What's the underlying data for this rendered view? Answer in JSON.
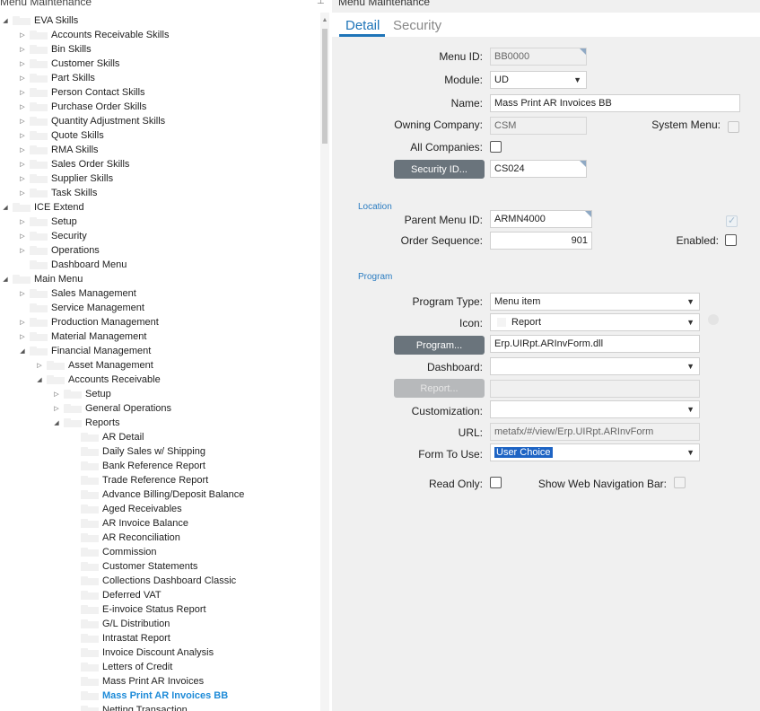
{
  "left_panel": {
    "title": "Menu Maintenance",
    "tree": [
      {
        "label": "EVA Skills",
        "level": 0,
        "expander": "expanded",
        "icon": "folder"
      },
      {
        "label": "Accounts Receivable Skills",
        "level": 1,
        "expander": "collapsed",
        "icon": "folder"
      },
      {
        "label": "Bin Skills",
        "level": 1,
        "expander": "collapsed",
        "icon": "folder"
      },
      {
        "label": "Customer Skills",
        "level": 1,
        "expander": "collapsed",
        "icon": "folder"
      },
      {
        "label": "Part Skills",
        "level": 1,
        "expander": "collapsed",
        "icon": "folder"
      },
      {
        "label": "Person Contact Skills",
        "level": 1,
        "expander": "collapsed",
        "icon": "folder"
      },
      {
        "label": "Purchase Order Skills",
        "level": 1,
        "expander": "collapsed",
        "icon": "folder"
      },
      {
        "label": "Quantity Adjustment Skills",
        "level": 1,
        "expander": "collapsed",
        "icon": "folder"
      },
      {
        "label": "Quote Skills",
        "level": 1,
        "expander": "collapsed",
        "icon": "folder"
      },
      {
        "label": "RMA Skills",
        "level": 1,
        "expander": "collapsed",
        "icon": "folder"
      },
      {
        "label": "Sales Order Skills",
        "level": 1,
        "expander": "collapsed",
        "icon": "folder"
      },
      {
        "label": "Supplier Skills",
        "level": 1,
        "expander": "collapsed",
        "icon": "folder"
      },
      {
        "label": "Task Skills",
        "level": 1,
        "expander": "collapsed",
        "icon": "folder"
      },
      {
        "label": "ICE Extend",
        "level": 0,
        "expander": "expanded",
        "icon": "folder"
      },
      {
        "label": "Setup",
        "level": 1,
        "expander": "collapsed",
        "icon": "folder"
      },
      {
        "label": "Security",
        "level": 1,
        "expander": "collapsed",
        "icon": "folder"
      },
      {
        "label": "Operations",
        "level": 1,
        "expander": "collapsed",
        "icon": "folder"
      },
      {
        "label": "Dashboard Menu",
        "level": 1,
        "expander": "none",
        "icon": "folder"
      },
      {
        "label": "Main Menu",
        "level": 0,
        "expander": "expanded",
        "icon": "folder"
      },
      {
        "label": "Sales Management",
        "level": 1,
        "expander": "collapsed",
        "icon": "folder"
      },
      {
        "label": "Service Management",
        "level": 1,
        "expander": "none",
        "icon": "folder"
      },
      {
        "label": "Production Management",
        "level": 1,
        "expander": "collapsed",
        "icon": "folder"
      },
      {
        "label": "Material Management",
        "level": 1,
        "expander": "collapsed",
        "icon": "folder"
      },
      {
        "label": "Financial Management",
        "level": 1,
        "expander": "expanded",
        "icon": "folder"
      },
      {
        "label": "Asset Management",
        "level": 2,
        "expander": "collapsed",
        "icon": "folder"
      },
      {
        "label": "Accounts Receivable",
        "level": 2,
        "expander": "expanded",
        "icon": "folder"
      },
      {
        "label": "Setup",
        "level": 3,
        "expander": "collapsed",
        "icon": "folder"
      },
      {
        "label": "General Operations",
        "level": 3,
        "expander": "collapsed",
        "icon": "folder"
      },
      {
        "label": "Reports",
        "level": 3,
        "expander": "expanded",
        "icon": "folder"
      },
      {
        "label": "AR Detail",
        "level": 4,
        "expander": "none",
        "icon": "folder"
      },
      {
        "label": "Daily Sales w/ Shipping",
        "level": 4,
        "expander": "none",
        "icon": "folder"
      },
      {
        "label": "Bank Reference Report",
        "level": 4,
        "expander": "none",
        "icon": "folder"
      },
      {
        "label": "Trade Reference Report",
        "level": 4,
        "expander": "none",
        "icon": "folder"
      },
      {
        "label": "Advance Billing/Deposit Balance",
        "level": 4,
        "expander": "none",
        "icon": "folder"
      },
      {
        "label": "Aged Receivables",
        "level": 4,
        "expander": "none",
        "icon": "folder"
      },
      {
        "label": "AR Invoice Balance",
        "level": 4,
        "expander": "none",
        "icon": "folder"
      },
      {
        "label": "AR Reconciliation",
        "level": 4,
        "expander": "none",
        "icon": "folder"
      },
      {
        "label": "Commission",
        "level": 4,
        "expander": "none",
        "icon": "folder"
      },
      {
        "label": "Customer Statements",
        "level": 4,
        "expander": "none",
        "icon": "folder"
      },
      {
        "label": "Collections Dashboard Classic",
        "level": 4,
        "expander": "none",
        "icon": "folder"
      },
      {
        "label": "Deferred VAT",
        "level": 4,
        "expander": "none",
        "icon": "folder"
      },
      {
        "label": "E-invoice Status Report",
        "level": 4,
        "expander": "none",
        "icon": "folder"
      },
      {
        "label": "G/L Distribution",
        "level": 4,
        "expander": "none",
        "icon": "folder"
      },
      {
        "label": "Intrastat Report",
        "level": 4,
        "expander": "none",
        "icon": "folder"
      },
      {
        "label": "Invoice Discount Analysis",
        "level": 4,
        "expander": "none",
        "icon": "folder"
      },
      {
        "label": "Letters of Credit",
        "level": 4,
        "expander": "none",
        "icon": "folder"
      },
      {
        "label": "Mass Print AR Invoices",
        "level": 4,
        "expander": "none",
        "icon": "folder"
      },
      {
        "label": "Mass Print AR Invoices BB",
        "level": 4,
        "expander": "none",
        "icon": "folder",
        "selected": true
      },
      {
        "label": "Netting Transaction",
        "level": 4,
        "expander": "none",
        "icon": "folder"
      }
    ]
  },
  "right_panel": {
    "title": "Menu Maintenance",
    "tabs": [
      {
        "label": "Detail",
        "active": true
      },
      {
        "label": "Security",
        "active": false
      }
    ],
    "labels": {
      "menu_id": "Menu ID:",
      "module": "Module:",
      "name": "Name:",
      "owning_company": "Owning Company:",
      "system_menu": "System Menu:",
      "all_companies": "All Companies:",
      "location_section": "Location",
      "parent_menu_id": "Parent Menu ID:",
      "order_sequence": "Order Sequence:",
      "enabled": "Enabled:",
      "program_section": "Program",
      "program_type": "Program Type:",
      "icon": "Icon:",
      "dashboard": "Dashboard:",
      "customization": "Customization:",
      "url": "URL:",
      "form_to_use": "Form To Use:",
      "read_only": "Read Only:",
      "show_web_nav": "Show Web Navigation Bar:"
    },
    "buttons": {
      "security_id": "Security ID...",
      "program": "Program...",
      "report": "Report..."
    },
    "values": {
      "menu_id": "BB0000",
      "module": "UD",
      "name": "Mass Print AR Invoices BB",
      "owning_company": "CSM",
      "security_id": "CS024",
      "parent_menu_id": "ARMN4000",
      "order_sequence": "901",
      "program_type": "Menu item",
      "icon": "Report",
      "program": "Erp.UIRpt.ARInvForm.dll",
      "dashboard": "",
      "report": "",
      "customization": "",
      "url": "metafx/#/view/Erp.UIRpt.ARInvForm",
      "form_to_use": "User Choice"
    },
    "checkboxes": {
      "system_menu": false,
      "all_companies": false,
      "location_checked": true,
      "enabled": false,
      "read_only": false,
      "show_web_nav": false
    }
  }
}
